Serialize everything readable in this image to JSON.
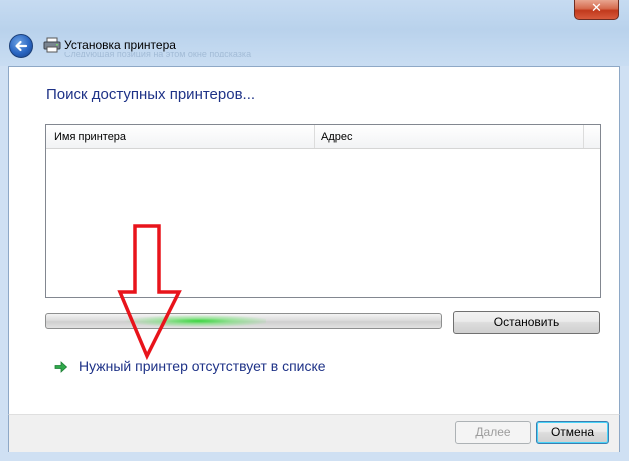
{
  "window": {
    "title": "Установка принтера",
    "close_label": "✕",
    "subtitle_ghost": "Следующая позиция на этом окне подсказка"
  },
  "main": {
    "heading": "Поиск доступных принтеров...",
    "list": {
      "columns": [
        "Имя принтера",
        "Адрес"
      ],
      "rows": []
    },
    "progress": {
      "state": "indeterminate"
    },
    "stop_button": "Остановить",
    "missing_printer_link": "Нужный принтер отсутствует в списке"
  },
  "footer": {
    "next_button": "Далее",
    "cancel_button": "Отмена"
  },
  "icons": {
    "back": "back-arrow-icon",
    "printer": "printer-icon",
    "link": "green-arrow-icon"
  },
  "colors": {
    "heading": "#1e3287",
    "annotation": "#e8141b",
    "progress_glow": "#3ad63f"
  }
}
